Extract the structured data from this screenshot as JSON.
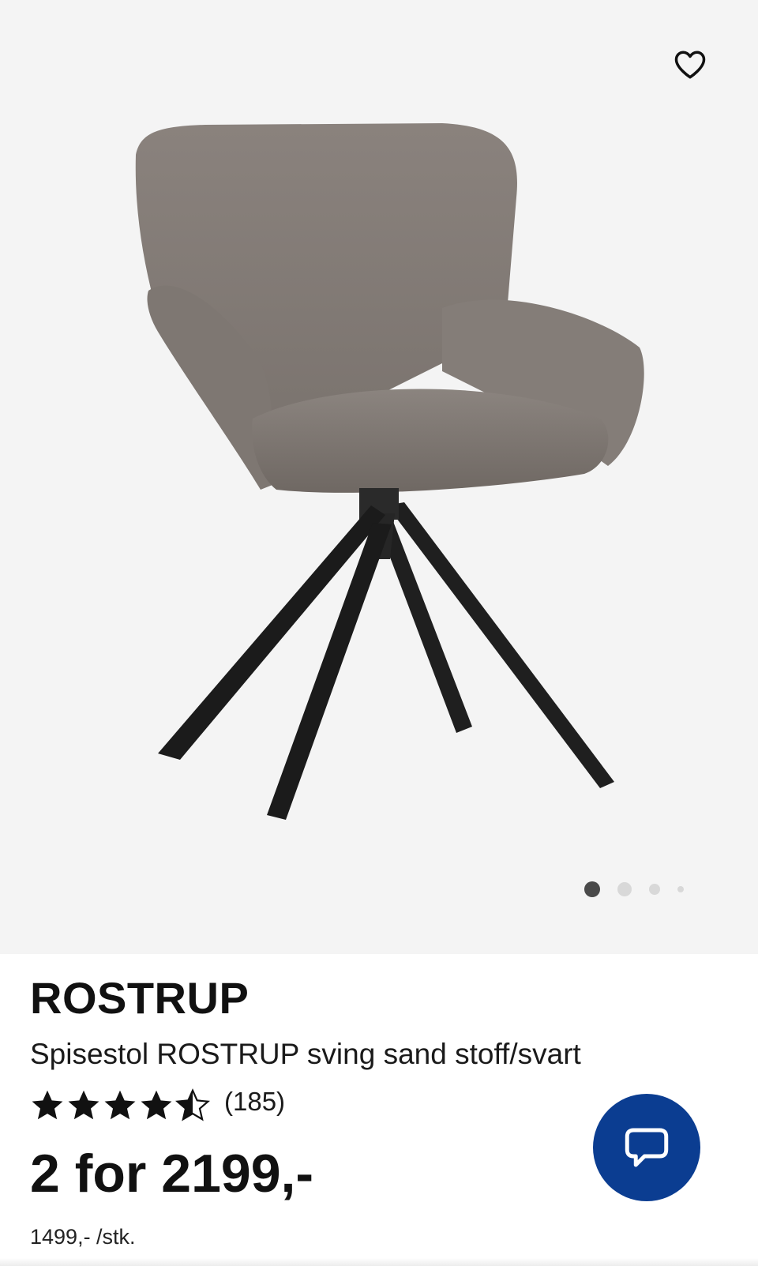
{
  "gallery": {
    "image_alt": "",
    "current_slide": 1,
    "slide_count": 4
  },
  "product": {
    "brand": "ROSTRUP",
    "subtitle": "Spisestol ROSTRUP sving sand stoff/svart",
    "rating": {
      "stars": 4.5,
      "max_stars": 5,
      "count_label": "(185)"
    },
    "price": "2 for 2199,-",
    "unit_price": "1499,- /stk."
  },
  "icons": {
    "favorite": "heart-outline-icon",
    "chat": "chat-bubble-icon",
    "star": "star-icon"
  },
  "colors": {
    "gallery_bg": "#f4f4f4",
    "chat_button": "#0b3d91",
    "text": "#111111",
    "dot_active": "#4a4a4a",
    "dot_inactive": "#d8d8d8"
  }
}
